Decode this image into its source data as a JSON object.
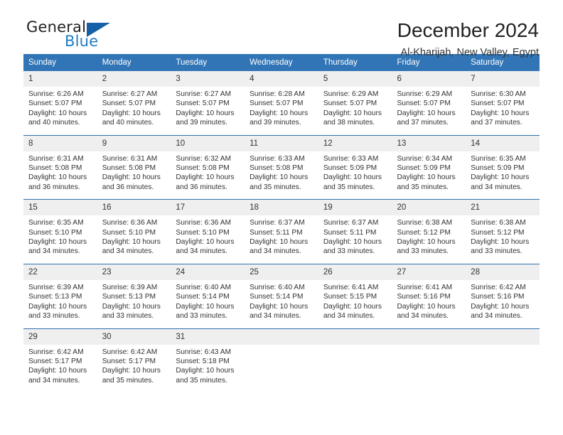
{
  "brand": {
    "name_part1": "General",
    "name_part2": "Blue",
    "triangle_color": "#1560a6",
    "blue_color": "#1d7dc4"
  },
  "header": {
    "title": "December 2024",
    "subtitle": "Al-Kharijah, New Valley, Egypt"
  },
  "theme": {
    "header_bg": "#3275b6",
    "daynum_bg": "#efefef",
    "row_separator": "#2f6fad",
    "text": "#333333"
  },
  "weekdays": [
    "Sunday",
    "Monday",
    "Tuesday",
    "Wednesday",
    "Thursday",
    "Friday",
    "Saturday"
  ],
  "weeks": [
    [
      {
        "day": "1",
        "sunrise": "Sunrise: 6:26 AM",
        "sunset": "Sunset: 5:07 PM",
        "daylight1": "Daylight: 10 hours",
        "daylight2": "and 40 minutes."
      },
      {
        "day": "2",
        "sunrise": "Sunrise: 6:27 AM",
        "sunset": "Sunset: 5:07 PM",
        "daylight1": "Daylight: 10 hours",
        "daylight2": "and 40 minutes."
      },
      {
        "day": "3",
        "sunrise": "Sunrise: 6:27 AM",
        "sunset": "Sunset: 5:07 PM",
        "daylight1": "Daylight: 10 hours",
        "daylight2": "and 39 minutes."
      },
      {
        "day": "4",
        "sunrise": "Sunrise: 6:28 AM",
        "sunset": "Sunset: 5:07 PM",
        "daylight1": "Daylight: 10 hours",
        "daylight2": "and 39 minutes."
      },
      {
        "day": "5",
        "sunrise": "Sunrise: 6:29 AM",
        "sunset": "Sunset: 5:07 PM",
        "daylight1": "Daylight: 10 hours",
        "daylight2": "and 38 minutes."
      },
      {
        "day": "6",
        "sunrise": "Sunrise: 6:29 AM",
        "sunset": "Sunset: 5:07 PM",
        "daylight1": "Daylight: 10 hours",
        "daylight2": "and 37 minutes."
      },
      {
        "day": "7",
        "sunrise": "Sunrise: 6:30 AM",
        "sunset": "Sunset: 5:07 PM",
        "daylight1": "Daylight: 10 hours",
        "daylight2": "and 37 minutes."
      }
    ],
    [
      {
        "day": "8",
        "sunrise": "Sunrise: 6:31 AM",
        "sunset": "Sunset: 5:08 PM",
        "daylight1": "Daylight: 10 hours",
        "daylight2": "and 36 minutes."
      },
      {
        "day": "9",
        "sunrise": "Sunrise: 6:31 AM",
        "sunset": "Sunset: 5:08 PM",
        "daylight1": "Daylight: 10 hours",
        "daylight2": "and 36 minutes."
      },
      {
        "day": "10",
        "sunrise": "Sunrise: 6:32 AM",
        "sunset": "Sunset: 5:08 PM",
        "daylight1": "Daylight: 10 hours",
        "daylight2": "and 36 minutes."
      },
      {
        "day": "11",
        "sunrise": "Sunrise: 6:33 AM",
        "sunset": "Sunset: 5:08 PM",
        "daylight1": "Daylight: 10 hours",
        "daylight2": "and 35 minutes."
      },
      {
        "day": "12",
        "sunrise": "Sunrise: 6:33 AM",
        "sunset": "Sunset: 5:09 PM",
        "daylight1": "Daylight: 10 hours",
        "daylight2": "and 35 minutes."
      },
      {
        "day": "13",
        "sunrise": "Sunrise: 6:34 AM",
        "sunset": "Sunset: 5:09 PM",
        "daylight1": "Daylight: 10 hours",
        "daylight2": "and 35 minutes."
      },
      {
        "day": "14",
        "sunrise": "Sunrise: 6:35 AM",
        "sunset": "Sunset: 5:09 PM",
        "daylight1": "Daylight: 10 hours",
        "daylight2": "and 34 minutes."
      }
    ],
    [
      {
        "day": "15",
        "sunrise": "Sunrise: 6:35 AM",
        "sunset": "Sunset: 5:10 PM",
        "daylight1": "Daylight: 10 hours",
        "daylight2": "and 34 minutes."
      },
      {
        "day": "16",
        "sunrise": "Sunrise: 6:36 AM",
        "sunset": "Sunset: 5:10 PM",
        "daylight1": "Daylight: 10 hours",
        "daylight2": "and 34 minutes."
      },
      {
        "day": "17",
        "sunrise": "Sunrise: 6:36 AM",
        "sunset": "Sunset: 5:10 PM",
        "daylight1": "Daylight: 10 hours",
        "daylight2": "and 34 minutes."
      },
      {
        "day": "18",
        "sunrise": "Sunrise: 6:37 AM",
        "sunset": "Sunset: 5:11 PM",
        "daylight1": "Daylight: 10 hours",
        "daylight2": "and 34 minutes."
      },
      {
        "day": "19",
        "sunrise": "Sunrise: 6:37 AM",
        "sunset": "Sunset: 5:11 PM",
        "daylight1": "Daylight: 10 hours",
        "daylight2": "and 33 minutes."
      },
      {
        "day": "20",
        "sunrise": "Sunrise: 6:38 AM",
        "sunset": "Sunset: 5:12 PM",
        "daylight1": "Daylight: 10 hours",
        "daylight2": "and 33 minutes."
      },
      {
        "day": "21",
        "sunrise": "Sunrise: 6:38 AM",
        "sunset": "Sunset: 5:12 PM",
        "daylight1": "Daylight: 10 hours",
        "daylight2": "and 33 minutes."
      }
    ],
    [
      {
        "day": "22",
        "sunrise": "Sunrise: 6:39 AM",
        "sunset": "Sunset: 5:13 PM",
        "daylight1": "Daylight: 10 hours",
        "daylight2": "and 33 minutes."
      },
      {
        "day": "23",
        "sunrise": "Sunrise: 6:39 AM",
        "sunset": "Sunset: 5:13 PM",
        "daylight1": "Daylight: 10 hours",
        "daylight2": "and 33 minutes."
      },
      {
        "day": "24",
        "sunrise": "Sunrise: 6:40 AM",
        "sunset": "Sunset: 5:14 PM",
        "daylight1": "Daylight: 10 hours",
        "daylight2": "and 33 minutes."
      },
      {
        "day": "25",
        "sunrise": "Sunrise: 6:40 AM",
        "sunset": "Sunset: 5:14 PM",
        "daylight1": "Daylight: 10 hours",
        "daylight2": "and 34 minutes."
      },
      {
        "day": "26",
        "sunrise": "Sunrise: 6:41 AM",
        "sunset": "Sunset: 5:15 PM",
        "daylight1": "Daylight: 10 hours",
        "daylight2": "and 34 minutes."
      },
      {
        "day": "27",
        "sunrise": "Sunrise: 6:41 AM",
        "sunset": "Sunset: 5:16 PM",
        "daylight1": "Daylight: 10 hours",
        "daylight2": "and 34 minutes."
      },
      {
        "day": "28",
        "sunrise": "Sunrise: 6:42 AM",
        "sunset": "Sunset: 5:16 PM",
        "daylight1": "Daylight: 10 hours",
        "daylight2": "and 34 minutes."
      }
    ],
    [
      {
        "day": "29",
        "sunrise": "Sunrise: 6:42 AM",
        "sunset": "Sunset: 5:17 PM",
        "daylight1": "Daylight: 10 hours",
        "daylight2": "and 34 minutes."
      },
      {
        "day": "30",
        "sunrise": "Sunrise: 6:42 AM",
        "sunset": "Sunset: 5:17 PM",
        "daylight1": "Daylight: 10 hours",
        "daylight2": "and 35 minutes."
      },
      {
        "day": "31",
        "sunrise": "Sunrise: 6:43 AM",
        "sunset": "Sunset: 5:18 PM",
        "daylight1": "Daylight: 10 hours",
        "daylight2": "and 35 minutes."
      },
      {
        "day": "",
        "sunrise": "",
        "sunset": "",
        "daylight1": "",
        "daylight2": ""
      },
      {
        "day": "",
        "sunrise": "",
        "sunset": "",
        "daylight1": "",
        "daylight2": ""
      },
      {
        "day": "",
        "sunrise": "",
        "sunset": "",
        "daylight1": "",
        "daylight2": ""
      },
      {
        "day": "",
        "sunrise": "",
        "sunset": "",
        "daylight1": "",
        "daylight2": ""
      }
    ]
  ]
}
